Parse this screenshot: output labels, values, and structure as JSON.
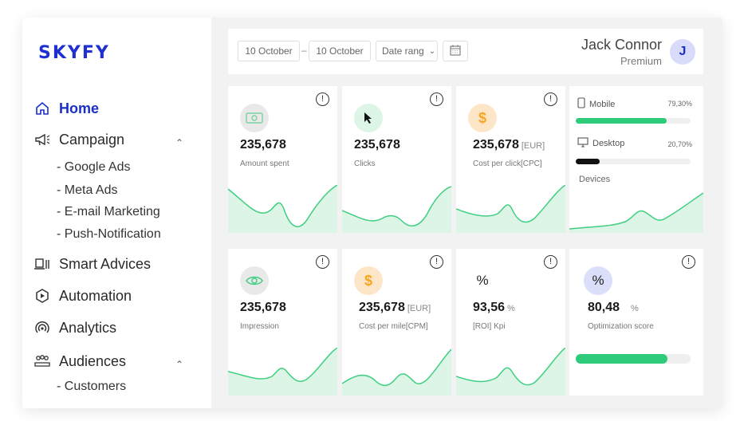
{
  "brand": {
    "logo": "SKYFY"
  },
  "nav": {
    "home": "Home",
    "campaign": "Campaign",
    "campaign_subs": [
      "- Google Ads",
      "- Meta Ads",
      "- E-mail Marketing",
      "- Push-Notification"
    ],
    "smart_advices": "Smart Advices",
    "automation": "Automation",
    "analytics": "Analytics",
    "audiences": "Audiences",
    "audiences_subs": [
      "- Customers"
    ]
  },
  "header": {
    "date_from": "10 October",
    "date_to": "10 October",
    "separator": "–",
    "range_placeholder": "Date rang",
    "user_name": "Jack Connor",
    "user_tier": "Premium",
    "avatar_initial": "J"
  },
  "cards": {
    "amount_spent": {
      "value": "235,678",
      "label": "Amount spent"
    },
    "clicks": {
      "value": "235,678",
      "label": "Clicks"
    },
    "cpc": {
      "value": "235,678",
      "unit": "[EUR]",
      "label": "Cost per click[CPC]",
      "icon": "$"
    },
    "devices": {
      "mobile_label": "Mobile",
      "mobile_pct": "79,30%",
      "mobile_fraction": 0.793,
      "desktop_label": "Desktop",
      "desktop_pct": "20,70%",
      "desktop_fraction": 0.207,
      "label": "Devices"
    },
    "impression": {
      "value": "235,678",
      "label": "Impression"
    },
    "cpm": {
      "value": "235,678",
      "unit": "[EUR]",
      "label": "Cost per mile[CPM]",
      "icon": "$"
    },
    "roi": {
      "value": "93,56",
      "unit": "%",
      "label": "[ROI] Kpi",
      "icon": "%"
    },
    "optimization": {
      "value": "80,48",
      "unit": "%",
      "label": "Optimization score",
      "icon": "%",
      "progress_fraction": 0.8
    }
  },
  "info_glyph": "!",
  "colors": {
    "accent": "#1a2fc9",
    "green": "#2ecc7a",
    "green_fill": "#dff6e8",
    "orange": "#f5a623"
  }
}
